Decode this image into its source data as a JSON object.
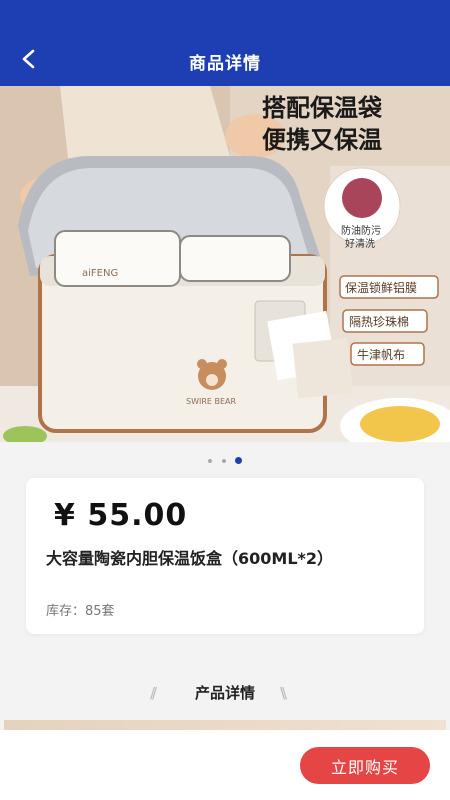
{
  "nav": {
    "title": "商品详情",
    "back_icon": "chevron-left-icon"
  },
  "hero": {
    "headline_1": "搭配保温袋",
    "headline_2": "便携又保温",
    "feature_1": "防油防污",
    "feature_1b": "好清洗",
    "feature_2": "保温锁鲜铝膜",
    "feature_3": "隔热珍珠棉",
    "feature_4": "牛津帆布",
    "brand_box": "aiFENG",
    "brand_bag": "SWIRE BEAR"
  },
  "carousel": {
    "count": 3,
    "active": 2
  },
  "product": {
    "price": "¥ 55.00",
    "name": "大容量陶瓷内胆保温饭盒（600ML*2）",
    "stock": "库存：85套"
  },
  "detail": {
    "heading": "产品详情"
  },
  "footer": {
    "buy_label": "立即购买"
  },
  "colors": {
    "nav": "#1d3fb3",
    "buy": "#e64545",
    "brown": "#b0734a"
  }
}
